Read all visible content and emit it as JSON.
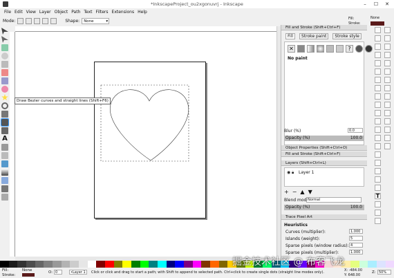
{
  "window": {
    "title": "*InkscapeProject_ou2xgonuvrj - Inkscape",
    "minimize": "–",
    "maximize": "☐",
    "close": "✕"
  },
  "menu": [
    "File",
    "Edit",
    "View",
    "Layer",
    "Object",
    "Path",
    "Text",
    "Filters",
    "Extensions",
    "Help"
  ],
  "toolctrl": {
    "mode_label": "Mode:",
    "shape_label": "Shape:",
    "shape_value": "None"
  },
  "indicator": {
    "fill_label": "Fill:",
    "fill_value": "None",
    "stroke_label": "Stroke:"
  },
  "tooltip": "Draw Bezier curves and straight lines (Shift+F6)",
  "fill_stroke": {
    "title": "Fill and Stroke (Shift+Ctrl+F)",
    "tabs": [
      "Fill",
      "Stroke paint",
      "Stroke style"
    ],
    "no_paint": "No paint",
    "blur_label": "Blur (%)",
    "blur_value": "0.0",
    "opacity_label": "Opacity (%)",
    "opacity_value": "100.0"
  },
  "collapsed_panels": [
    "Object Properties (Shift+Ctrl+O)",
    "Fill and Stroke (Shift+Ctrl+F)"
  ],
  "layers": {
    "title": "Layers (Shift+Ctrl+L)",
    "layer_name": "Layer 1",
    "blend_label": "Blend mode:",
    "blend_value": "Normal",
    "opacity_label": "Opacity (%)",
    "opacity_value": "100.0"
  },
  "trace": {
    "title": "Trace Pixel Art",
    "section": "Heuristics",
    "rows": [
      {
        "label": "Curves (multiplier):",
        "value": "1.000"
      },
      {
        "label": "Islands (weight):",
        "value": "5"
      },
      {
        "label": "Sparse pixels (window radius):",
        "value": "4"
      },
      {
        "label": "Sparse pixels (multiplier):",
        "value": "1.000"
      }
    ]
  },
  "status": {
    "fill_label": "Fill:",
    "fill_value": "None",
    "stroke_label": "Stroke:",
    "opacity_label": "O:",
    "opacity_value": "0",
    "layer_value": "•Layer 1",
    "message": "Click or click and drag to start a path; with Shift to append to selected path. Ctrl+click to create single dots (straight line modes only).",
    "x_value": "X: -484.00",
    "y_value": "Y: 648.00",
    "zoom_label": "Z:",
    "zoom_value": "50%"
  },
  "watermark": "掘金技术社区 @ 布客飞龙",
  "colors": {
    "swatches": [
      "#000000",
      "#1a1a1a",
      "#333333",
      "#4d4d4d",
      "#666666",
      "#808080",
      "#999999",
      "#b3b3b3",
      "#cccccc",
      "#e6e6e6",
      "#ffffff",
      "#800000",
      "#ff0000",
      "#808000",
      "#ffff00",
      "#008000",
      "#00ff00",
      "#008080",
      "#00ffff",
      "#000080",
      "#0000ff",
      "#800080",
      "#ff00ff",
      "#803300",
      "#ff6600",
      "#806600",
      "#ffcc00",
      "#668000",
      "#ccff00",
      "#008033",
      "#00ff66",
      "#006680",
      "#00ccff",
      "#330080",
      "#6600ff",
      "#800066",
      "#ff00cc",
      "#f4d7d7",
      "#ffe6d5",
      "#ffeeaa",
      "#e5ff80",
      "#ccffdd",
      "#aaeeff",
      "#dde3ff",
      "#f0d9ff"
    ]
  }
}
